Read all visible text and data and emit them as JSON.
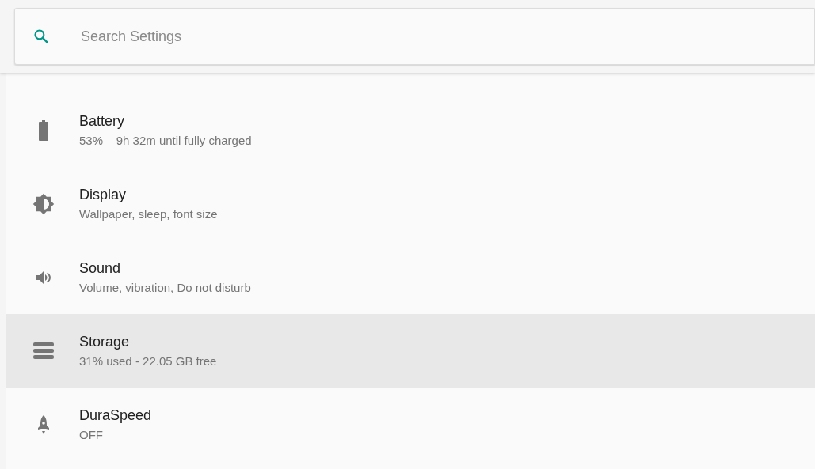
{
  "search": {
    "placeholder": "Search Settings"
  },
  "items": [
    {
      "kind": "battery",
      "title": "Battery",
      "summary": "53% – 9h 32m until fully charged",
      "selected": false
    },
    {
      "kind": "display",
      "title": "Display",
      "summary": "Wallpaper, sleep, font size",
      "selected": false
    },
    {
      "kind": "sound",
      "title": "Sound",
      "summary": "Volume, vibration, Do not disturb",
      "selected": false
    },
    {
      "kind": "storage",
      "title": "Storage",
      "summary": "31% used - 22.05 GB free",
      "selected": true
    },
    {
      "kind": "speed",
      "title": "DuraSpeed",
      "summary": "OFF",
      "selected": false
    }
  ]
}
